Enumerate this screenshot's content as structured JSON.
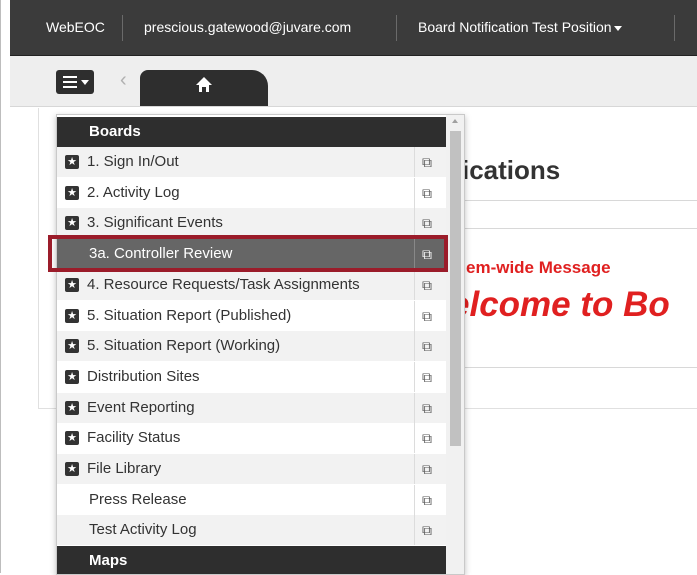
{
  "topbar": {
    "app": "WebEOC",
    "user": "prescious.gatewood@juvare.com",
    "position": "Board Notification Test Position"
  },
  "toolbar": {
    "menu_icon": "hamburger-menu-icon",
    "back_icon": "chevron-left-icon",
    "home_icon": "home-icon"
  },
  "page": {
    "title_fragment": "ications",
    "system_message_fragment": "em-wide Message",
    "welcome_fragment": "elcome to Bo"
  },
  "dropdown": {
    "sections": [
      {
        "header": "Boards",
        "items": [
          {
            "label": "1. Sign In/Out",
            "starred": true
          },
          {
            "label": "2. Activity Log",
            "starred": true
          },
          {
            "label": "3. Significant Events",
            "starred": true
          },
          {
            "label": "3a. Controller Review",
            "starred": false,
            "selected": true
          },
          {
            "label": "4. Resource Requests/Task Assignments",
            "starred": true
          },
          {
            "label": "5. Situation Report (Published)",
            "starred": true
          },
          {
            "label": "5. Situation Report (Working)",
            "starred": true
          },
          {
            "label": "Distribution Sites",
            "starred": true
          },
          {
            "label": "Event Reporting",
            "starred": true
          },
          {
            "label": "Facility Status",
            "starred": true
          },
          {
            "label": "File Library",
            "starred": true
          },
          {
            "label": "Press Release",
            "starred": false
          },
          {
            "label": "Test Activity Log",
            "starred": false
          }
        ]
      },
      {
        "header": "Maps",
        "items": []
      }
    ]
  },
  "colors": {
    "topbar_bg": "#3b3b3b",
    "menu_header_bg": "#2e2e2e",
    "selected_bg": "#666666",
    "highlight_border": "#9b1c2a",
    "alert_red": "#e02020"
  }
}
